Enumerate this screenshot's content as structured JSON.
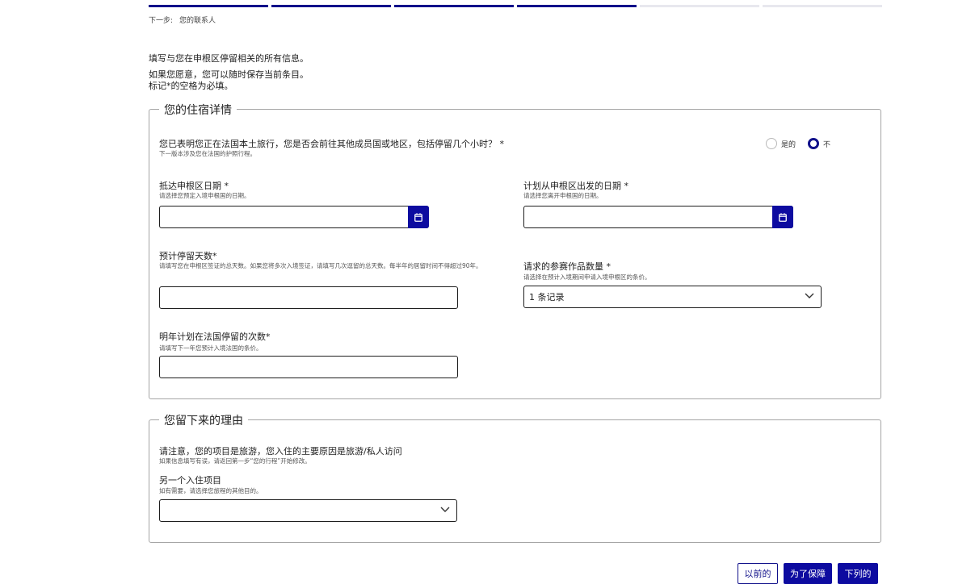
{
  "progress": {
    "total_steps": 6,
    "completed_steps": 4
  },
  "next_step": {
    "label": "下一步:",
    "value": "您的联系人"
  },
  "intro": {
    "line1": "填写与您在申根区停留相关的所有信息。",
    "line2": "如果您愿意，您可以随时保存当前条目。",
    "line3": "标记*的空格为必填。"
  },
  "accommodation": {
    "legend": "您的住宿详情",
    "transit_question": {
      "label": "您已表明您正在法国本土旅行，您是否会前往其他成员国或地区，包括停留几个小时？ *",
      "hint": "下一版本涉及您在法国的护照行程。",
      "options": [
        "是的",
        "不"
      ],
      "selected": "不"
    },
    "arrival_date": {
      "label": "抵达申根区日期 *",
      "hint": "请选择您预定入境申根国的日期。",
      "value": ""
    },
    "departure_date": {
      "label": "计划从申根区出发的日期 *",
      "hint": "请选择您离开申根国的日期。",
      "value": ""
    },
    "stay_days": {
      "label": "预计停留天数*",
      "hint": "请填写您在申根区签证的总天数。如果您将多次入境签证，请填写几次逗留的总天数。每半年的居留时间不得超过90年。",
      "value": ""
    },
    "entries_requested": {
      "label": "请求的参赛作品数量 *",
      "hint": "请选择在预计入境期间申请入境申根区的条价。",
      "selected": "1 条记录"
    },
    "stays_next_year": {
      "label": "明年计划在法国停留的次数*",
      "hint": "请填写下一年您预计入境法国的条价。",
      "value": ""
    }
  },
  "reasons": {
    "legend": "您留下来的理由",
    "note": "请注意，您的项目是旅游，您入住的主要原因是旅游/私人访问",
    "note_hint": "如果信息填写有误，请返回第一步“您的行程”开始修改。",
    "other_item": {
      "label": "另一个入住项目",
      "hint": "如有需要，请选择您旅程的其他目的。",
      "selected": ""
    }
  },
  "buttons": {
    "previous": "以前的",
    "save": "为了保障",
    "next": "下列的"
  },
  "colors": {
    "accent": "#0d0ba0",
    "progress_done": "#10108a",
    "border": "#a5a5a5"
  }
}
